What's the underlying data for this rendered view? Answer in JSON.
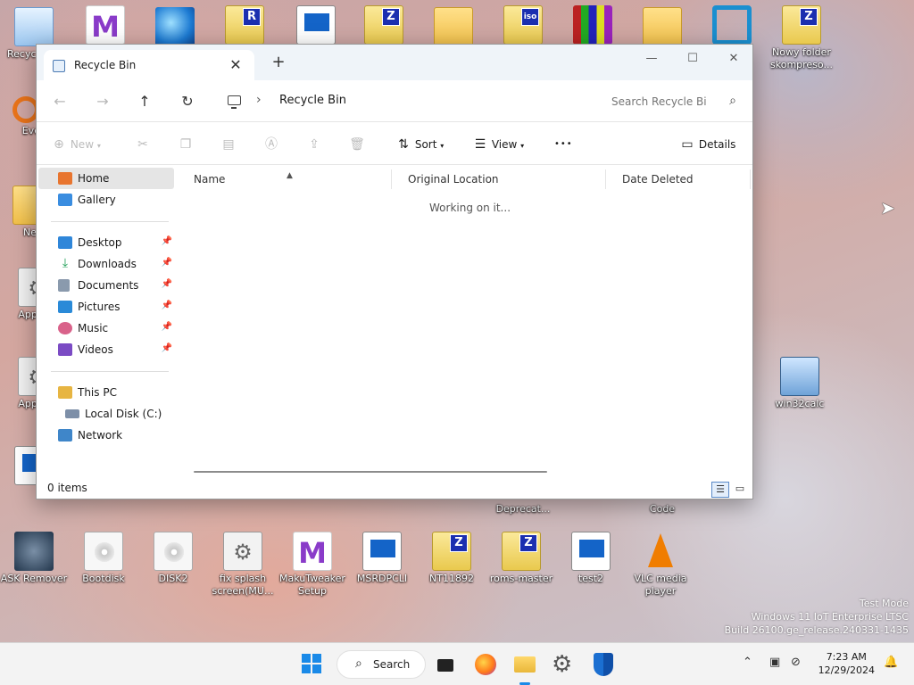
{
  "desktop": {
    "icons": [
      {
        "label": "Recyc"
      },
      {
        "label": "Every"
      },
      {
        "label": "New"
      },
      {
        "label": "Applic"
      },
      {
        "label": "Applic"
      },
      {
        "label": "Nowy folder skompreso..."
      },
      {
        "label": "win32calc"
      },
      {
        "label": "ASK Remover"
      },
      {
        "label": "Bootdisk"
      },
      {
        "label": "DISK2"
      },
      {
        "label": "fix splash screen(MU..."
      },
      {
        "label": "MakuTweaker Setup"
      },
      {
        "label": "MSRDPCLI"
      },
      {
        "label": "NT11892"
      },
      {
        "label": "roms-master"
      },
      {
        "label": "test2"
      },
      {
        "label": "VLC media player"
      },
      {
        "label": "Deprecat..."
      },
      {
        "label": "Code"
      }
    ]
  },
  "window": {
    "tab_title": "Recycle Bin",
    "tab_close": "✕",
    "tab_add": "+",
    "minimize": "—",
    "maximize": "☐",
    "close": "✕"
  },
  "address": {
    "back": "←",
    "forward": "→",
    "up": "↑",
    "refresh": "↻",
    "separator": "›",
    "crumb": "Recycle Bin",
    "search_placeholder": "Search Recycle Bi",
    "search_icon": "⌕"
  },
  "toolbar": {
    "new_label": "New",
    "sort_label": "Sort",
    "view_label": "View",
    "more_label": "•••",
    "details_label": "Details"
  },
  "nav": {
    "home": "Home",
    "gallery": "Gallery",
    "desktop": "Desktop",
    "downloads": "Downloads",
    "documents": "Documents",
    "pictures": "Pictures",
    "music": "Music",
    "videos": "Videos",
    "this_pc": "This PC",
    "local_disk": "Local Disk (C:)",
    "network": "Network",
    "pin": "📌"
  },
  "columns": {
    "name": "Name",
    "original_location": "Original Location",
    "date_deleted": "Date Deleted"
  },
  "content": {
    "working": "Working on it..."
  },
  "status": {
    "count": "0 items"
  },
  "watermark": {
    "line1": "Test Mode",
    "line2": "Windows 11 IoT Enterprise LTSC",
    "line3": "Build 26100.ge_release.240331-1435"
  },
  "taskbar": {
    "search_label": "Search",
    "time": "7:23 AM",
    "date": "12/29/2024",
    "chevron": "⌃"
  },
  "colors": {
    "accent": "#1a8ae8",
    "selection": "#e5e5e5"
  }
}
